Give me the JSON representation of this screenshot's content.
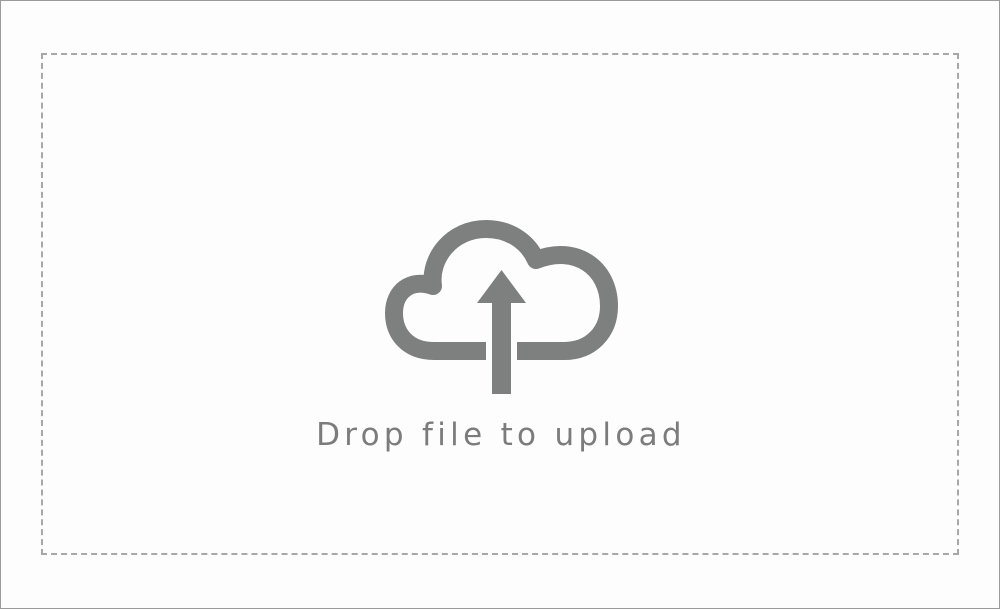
{
  "dropzone": {
    "label": "Drop file to upload",
    "icon": "cloud-upload-icon"
  },
  "colors": {
    "icon": "#7e8080",
    "label": "#7c7c7c",
    "dashed_border": "#a8a8a8",
    "outer_border": "#9a9a9a",
    "background": "#fdfdfd"
  }
}
